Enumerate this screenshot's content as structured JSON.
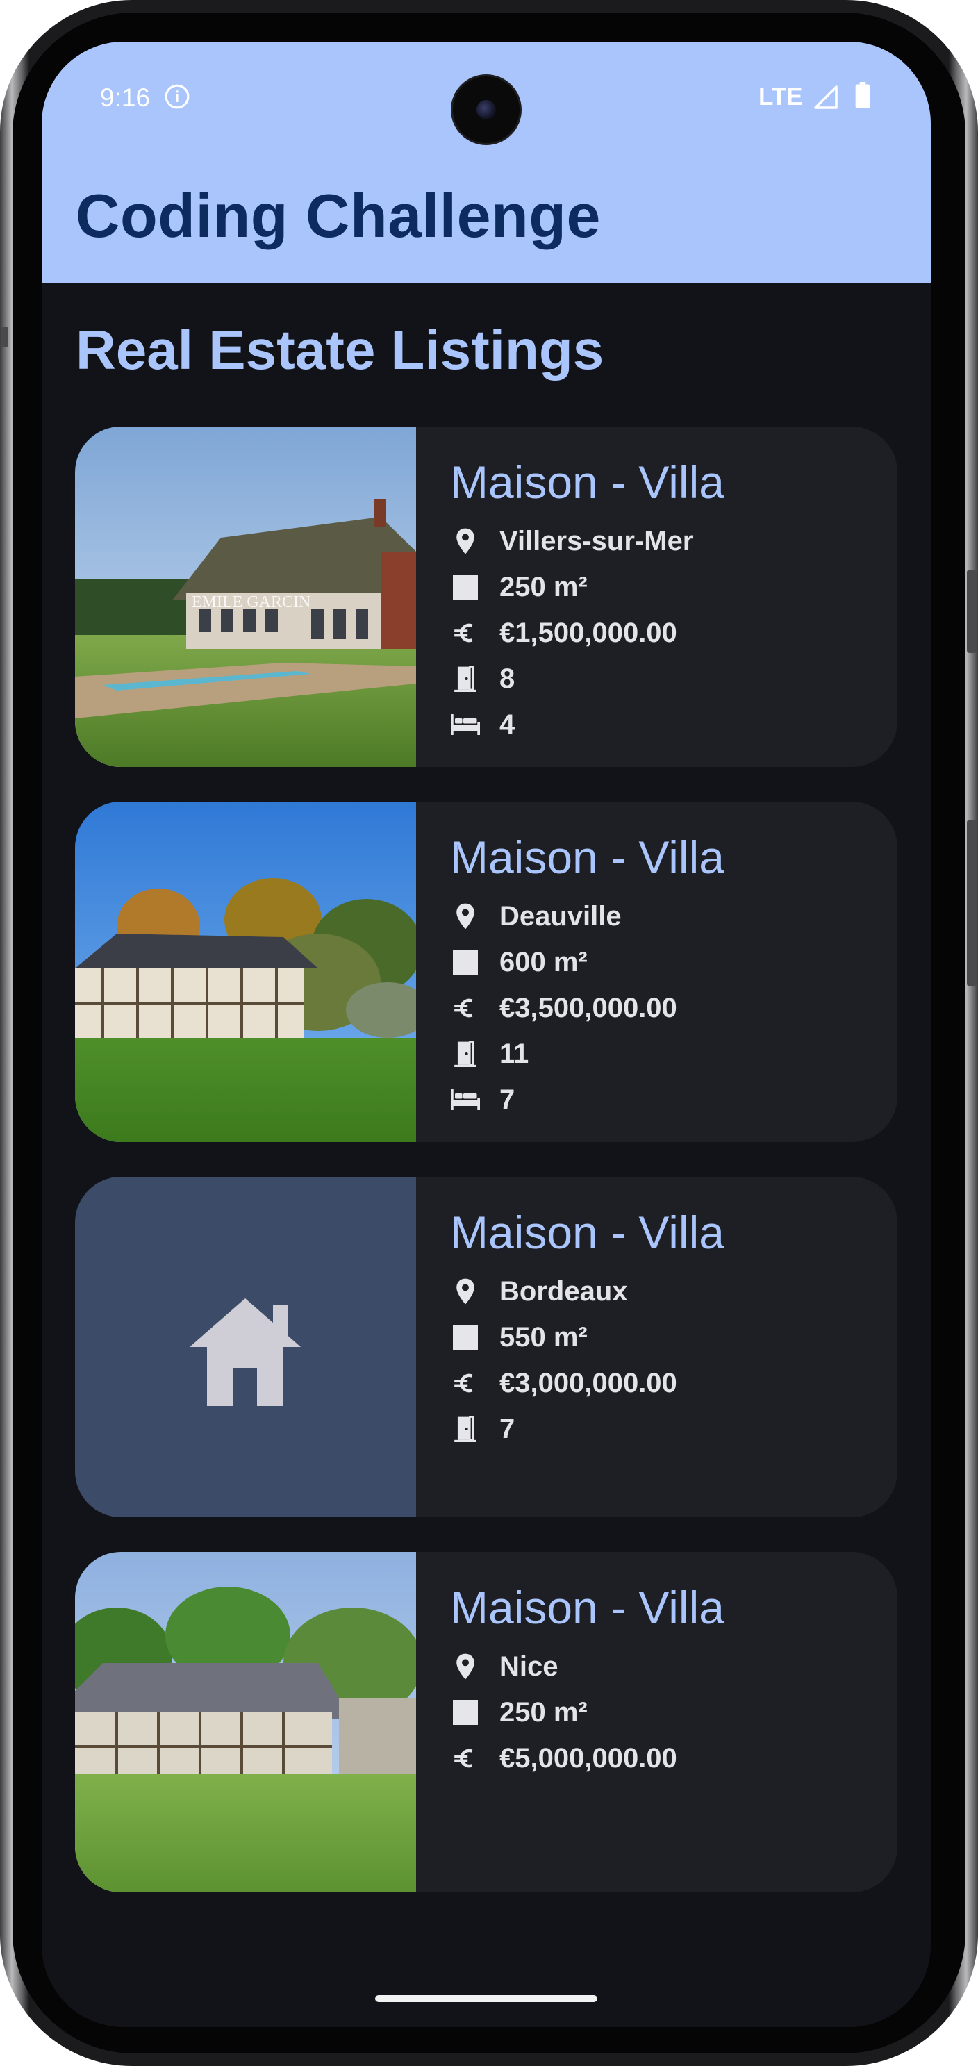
{
  "status_bar": {
    "time": "9:16",
    "network": "LTE",
    "icons": [
      "info-icon",
      "signal-icon",
      "battery-icon"
    ]
  },
  "app_bar": {
    "title": "Coding Challenge"
  },
  "section": {
    "title": "Real Estate Listings"
  },
  "colors": {
    "app_bar_bg": "#a9c5fb",
    "app_bar_text": "#0d2b5e",
    "screen_bg": "#121318",
    "card_bg": "#1e1f25",
    "accent_text": "#a9c5fb",
    "placeholder_bg": "#3c4b68"
  },
  "listings": [
    {
      "title": "Maison - Villa",
      "city": "Villers-sur-Mer",
      "area": "250 m²",
      "price": "€1,500,000.00",
      "rooms": "8",
      "bedrooms": "4",
      "image": "photo-thatched-house-with-pool",
      "watermark": "EMILE GARCIN"
    },
    {
      "title": "Maison - Villa",
      "city": "Deauville",
      "area": "600 m²",
      "price": "€3,500,000.00",
      "rooms": "11",
      "bedrooms": "7",
      "image": "photo-half-timbered-manor"
    },
    {
      "title": "Maison - Villa",
      "city": "Bordeaux",
      "area": "550 m²",
      "price": "€3,000,000.00",
      "rooms": "7",
      "image": "house-placeholder-icon"
    },
    {
      "title": "Maison - Villa",
      "city": "Nice",
      "area": "250 m²",
      "price": "€5,000,000.00",
      "image": "photo-norman-house-lawn"
    }
  ]
}
